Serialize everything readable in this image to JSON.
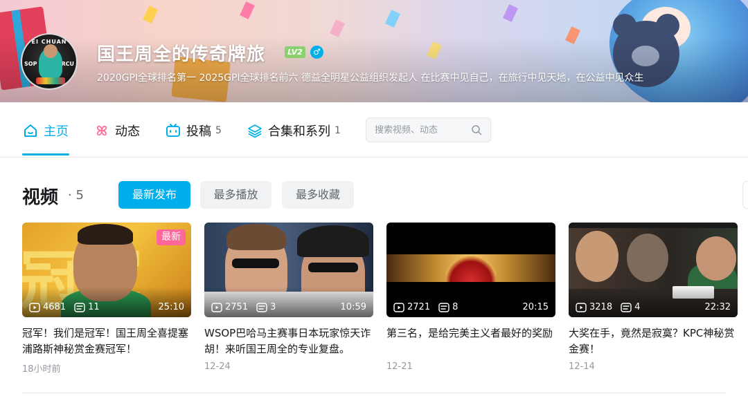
{
  "header": {
    "username": "国王周全的传奇牌旅",
    "level": "LV2",
    "gender_symbol": "♂",
    "bio": "2020GPI全球排名第一 2025GPI全球排名前六 德益全明星公益组织发起人 在比赛中见自己，在旅行中见天地，在公益中见众生",
    "avatar_text": {
      "top": "EI CHUAN",
      "left": "SOP",
      "right": "RCU"
    }
  },
  "nav": {
    "tabs": [
      {
        "label": "主页",
        "count": "",
        "icon": "home-icon"
      },
      {
        "label": "动态",
        "count": "",
        "icon": "pinwheel-icon"
      },
      {
        "label": "投稿",
        "count": "5",
        "icon": "tv-icon"
      },
      {
        "label": "合集和系列",
        "count": "1",
        "icon": "layers-icon"
      }
    ],
    "active_tab": 0,
    "search_placeholder": "搜索视频、动态"
  },
  "videos_section": {
    "title": "视频",
    "count": "· 5",
    "sort_buttons": [
      "最新发布",
      "最多播放",
      "最多收藏"
    ],
    "active_sort": 0
  },
  "videos": [
    {
      "title": "冠军！我们是冠军！国王周全喜提塞浦路斯神秘赏金赛冠军！",
      "views": "4681",
      "danmaku": "11",
      "duration": "25:10",
      "date": "18小时前",
      "badge": "最新",
      "thumb_text": "冠军"
    },
    {
      "title": "WSOP巴哈马主赛事日本玩家惊天诈胡！来听国王周全的专业复盘。",
      "views": "2751",
      "danmaku": "3",
      "duration": "10:59",
      "date": "12-24",
      "badge": ""
    },
    {
      "title": "第三名，是给完美主义者最好的奖励",
      "views": "2721",
      "danmaku": "8",
      "duration": "20:15",
      "date": "12-21",
      "badge": ""
    },
    {
      "title": "大奖在手，竟然是寂寞？KPC神秘赏金赛！",
      "views": "3218",
      "danmaku": "4",
      "duration": "22:32",
      "date": "12-14",
      "badge": ""
    }
  ],
  "colors": {
    "accent": "#00aeec",
    "badge_pink": "#ff6699",
    "level_green": "#8bd06e"
  }
}
